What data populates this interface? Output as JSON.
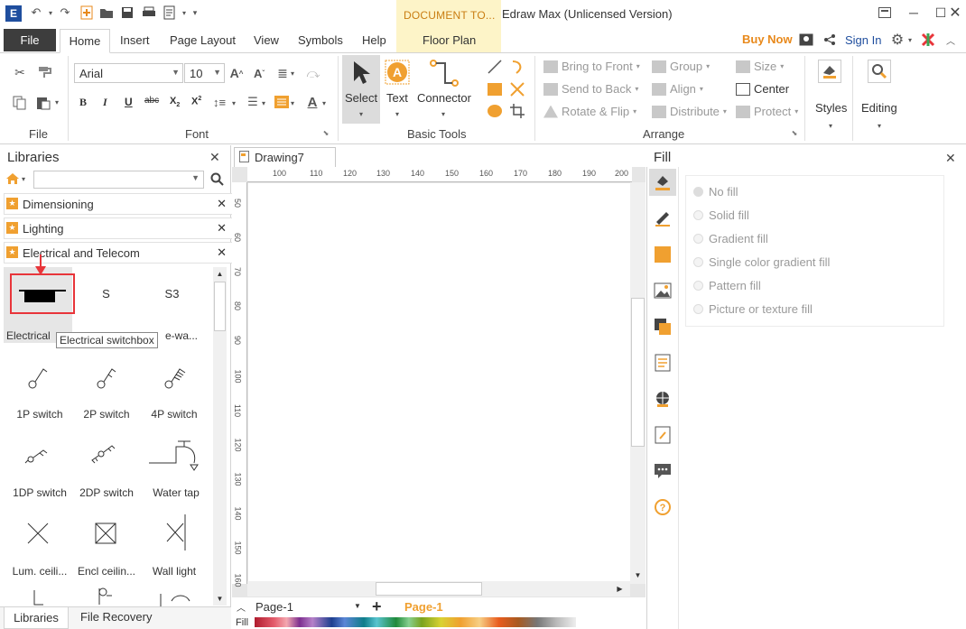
{
  "app": {
    "title": "Edraw Max (Unlicensed Version)",
    "context_tab_title": "DOCUMENT TO...",
    "logo_text": "E"
  },
  "menu": {
    "file": "File",
    "tabs": [
      "Home",
      "Insert",
      "Page Layout",
      "View",
      "Symbols",
      "Help"
    ],
    "context_tab": "Floor Plan",
    "buy_now": "Buy Now",
    "sign_in": "Sign In"
  },
  "ribbon": {
    "groups": {
      "file": "File",
      "font": "Font",
      "basic_tools": "Basic Tools",
      "arrange": "Arrange"
    },
    "font_name": "Arial",
    "font_size": "10",
    "tools": {
      "select": "Select",
      "text": "Text",
      "connector": "Connector"
    },
    "arrange": {
      "bring_to_front": "Bring to Front",
      "send_to_back": "Send to Back",
      "rotate_flip": "Rotate & Flip",
      "group": "Group",
      "align": "Align",
      "distribute": "Distribute",
      "size": "Size",
      "center": "Center",
      "protect": "Protect"
    },
    "styles": "Styles",
    "editing": "Editing"
  },
  "libraries": {
    "title": "Libraries",
    "categories": [
      "Dimensioning",
      "Lighting",
      "Electrical and Telecom"
    ],
    "shapes": [
      {
        "label": "Electrical",
        "glyph": ""
      },
      {
        "label": "",
        "glyph": "S"
      },
      {
        "label": "e-wa...",
        "glyph": "S3"
      },
      {
        "label": "1P switch",
        "glyph": ""
      },
      {
        "label": "2P switch",
        "glyph": ""
      },
      {
        "label": "4P switch",
        "glyph": ""
      },
      {
        "label": "1DP switch",
        "glyph": ""
      },
      {
        "label": "2DP switch",
        "glyph": ""
      },
      {
        "label": "Water tap",
        "glyph": ""
      },
      {
        "label": "Lum. ceili...",
        "glyph": ""
      },
      {
        "label": "Encl ceilin...",
        "glyph": ""
      },
      {
        "label": "Wall light",
        "glyph": ""
      }
    ],
    "tooltip": "Electrical switchbox",
    "bottom_tabs": [
      "Libraries",
      "File Recovery"
    ]
  },
  "canvas": {
    "doc_tab": "Drawing7",
    "ruler_top": [
      "100",
      "110",
      "120",
      "130",
      "140",
      "150",
      "160",
      "170",
      "180",
      "190",
      "200"
    ],
    "ruler_left": [
      "50",
      "60",
      "70",
      "80",
      "90",
      "100",
      "110",
      "120",
      "130",
      "140",
      "150",
      "160"
    ],
    "page_select": "Page-1",
    "active_page": "Page-1",
    "fill_label": "Fill"
  },
  "fill_panel": {
    "title": "Fill",
    "options": [
      "No fill",
      "Solid fill",
      "Gradient fill",
      "Single color gradient fill",
      "Pattern fill",
      "Picture or texture fill"
    ],
    "selected": "No fill"
  },
  "colors": {
    "accent_orange": "#f0a030",
    "file_tab_bg": "#3d3d3d",
    "highlight_red": "#e8353a",
    "brand_blue": "#1f4e9e",
    "context_tab_bg": "#fdf4c8"
  }
}
